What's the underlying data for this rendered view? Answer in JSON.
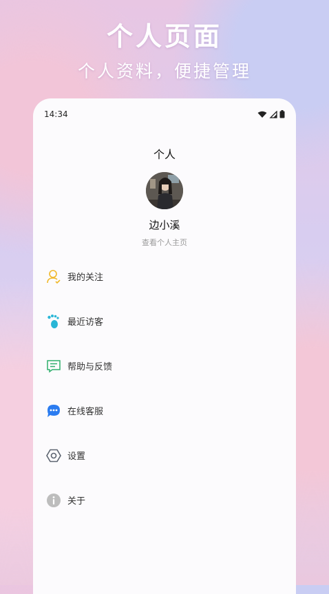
{
  "promo": {
    "title": "个人页面",
    "subtitle": "个人资料，便捷管理"
  },
  "status_bar": {
    "time": "14:34",
    "icons": [
      "wifi-icon",
      "cellular-signal-icon",
      "battery-icon"
    ]
  },
  "page": {
    "title": "个人"
  },
  "profile": {
    "name": "边小溪",
    "link_text": "查看个人主页"
  },
  "menu": {
    "items": [
      {
        "label": "我的关注",
        "icon": "user-follow-icon",
        "color": "#f0b829"
      },
      {
        "label": "最近访客",
        "icon": "footprint-icon",
        "color": "#29b6d6"
      },
      {
        "label": "帮助与反馈",
        "icon": "feedback-icon",
        "color": "#2eaf6d"
      },
      {
        "label": "在线客服",
        "icon": "chat-bubble-icon",
        "color": "#2b7cf0"
      },
      {
        "label": "设置",
        "icon": "settings-hexagon-icon",
        "color": "#5c6470"
      },
      {
        "label": "关于",
        "icon": "info-icon",
        "color": "#bdbdbd"
      }
    ]
  }
}
